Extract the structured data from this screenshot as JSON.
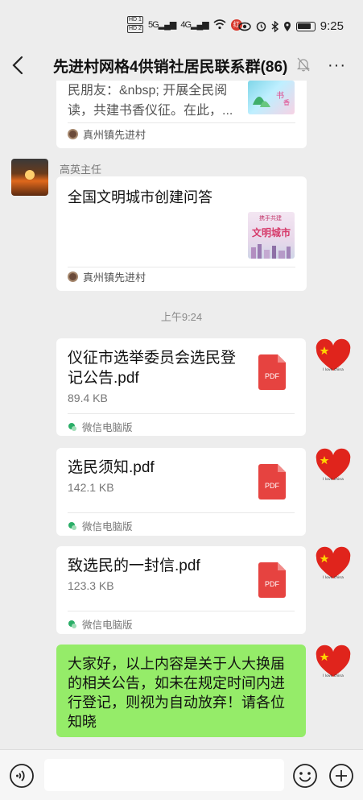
{
  "status_bar": {
    "hd1": "HD 1",
    "hd2": "HD 2",
    "signal1": "5G",
    "signal2": "4G",
    "badge": "红",
    "time": "9:25"
  },
  "header": {
    "title": "先进村网格4供销社居民联系群(86)",
    "more": "···"
  },
  "messages": {
    "card1": {
      "text_line1": "民朋友：&nbsp; 开展全民阅",
      "text_line2": "读，共建书香仪征。在此，...",
      "source": "真州镇先进村"
    },
    "card2": {
      "sender": "高英主任",
      "title": "全国文明城市创建问答",
      "thumb_small": "携手共建",
      "thumb_text": "文明城市",
      "source": "真州镇先进村"
    },
    "timestamp": "上午9:24",
    "file1": {
      "name_line1": "仪征市选举委员会选民登",
      "name_line2": "记公告.pdf",
      "size": "89.4 KB",
      "source": "微信电脑版",
      "pdf_label": "PDF"
    },
    "file2": {
      "name": "选民须知.pdf",
      "size": "142.1 KB",
      "source": "微信电脑版",
      "pdf_label": "PDF"
    },
    "file3": {
      "name": "致选民的一封信.pdf",
      "size": "123.3 KB",
      "source": "微信电脑版",
      "pdf_label": "PDF"
    },
    "text_msg": "大家好，以上内容是关于人大换届的相关公告，如未在规定时间内进行登记，则视为自动放弃！请各位知晓",
    "heart_caption": "I love china"
  },
  "colors": {
    "bubble_green": "#95ec69",
    "pdf_red": "#e64340",
    "background": "#ededed"
  }
}
